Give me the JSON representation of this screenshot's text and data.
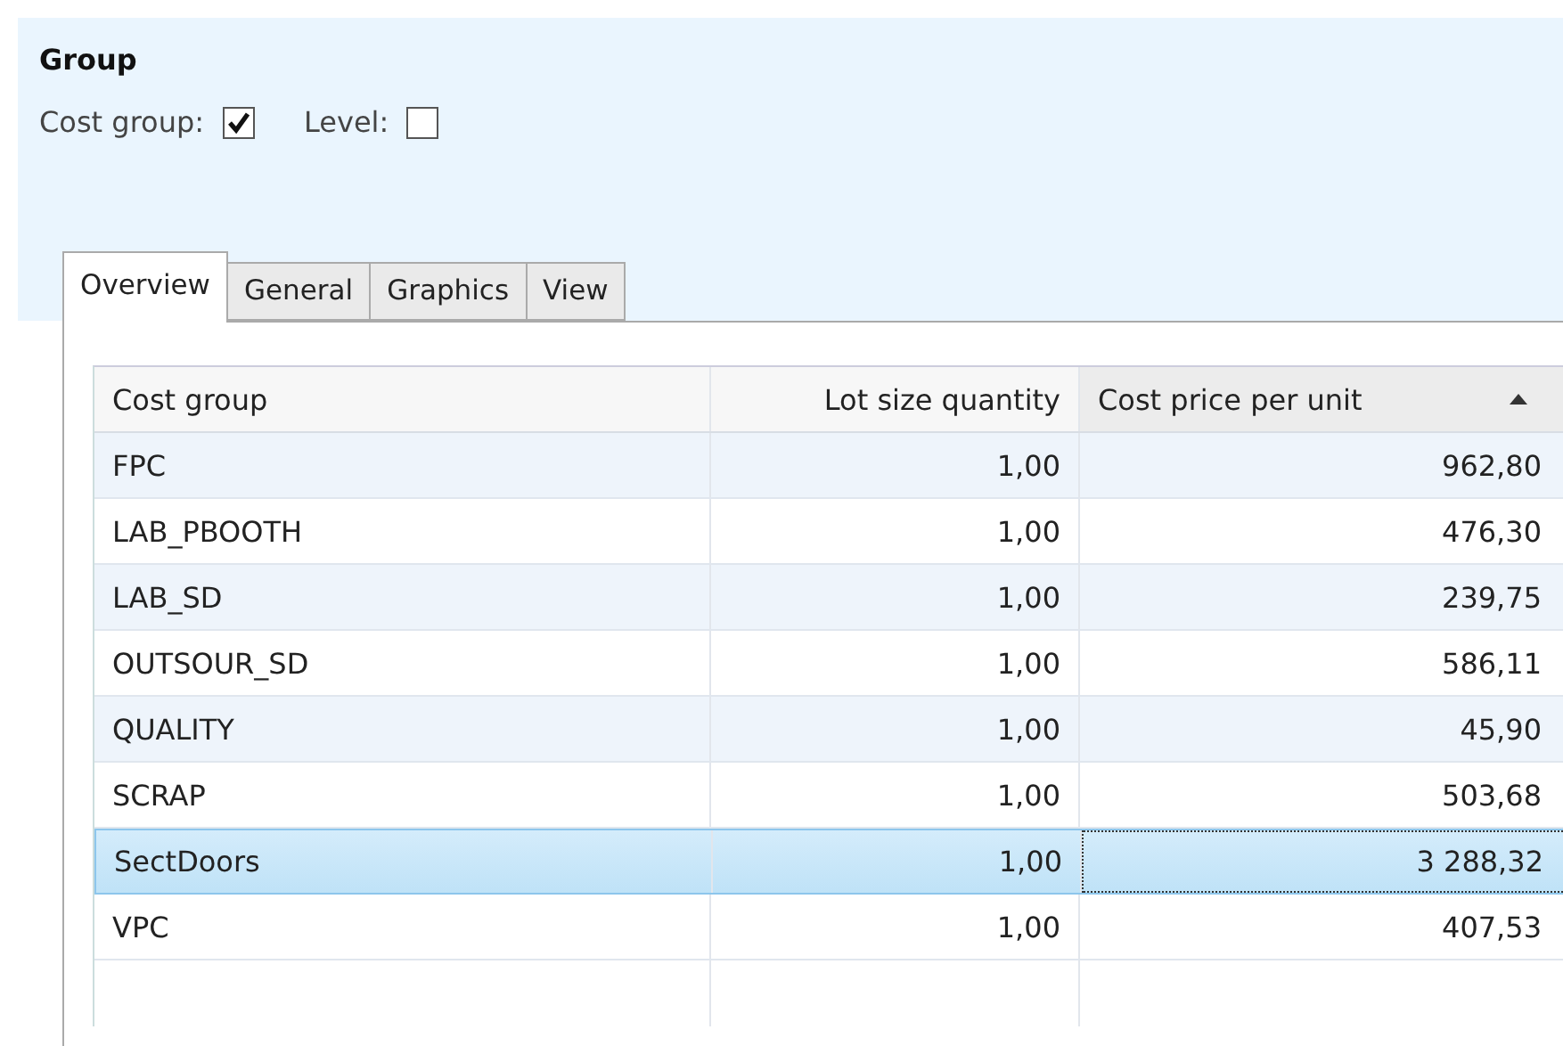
{
  "group": {
    "title": "Group",
    "fields": [
      {
        "label": "Cost group:",
        "checked": true
      },
      {
        "label": "Level:",
        "checked": false
      }
    ]
  },
  "tabs": [
    {
      "label": "Overview",
      "selected": true
    },
    {
      "label": "General",
      "selected": false
    },
    {
      "label": "Graphics",
      "selected": false
    },
    {
      "label": "View",
      "selected": false
    }
  ],
  "table": {
    "columns": [
      {
        "label": "Cost group",
        "sorted": false
      },
      {
        "label": "Lot size quantity",
        "sorted": false
      },
      {
        "label": "Cost price per unit",
        "sorted": true
      }
    ],
    "rows": [
      {
        "cells": [
          "FPC",
          "1,00",
          "962,80"
        ],
        "selected": false
      },
      {
        "cells": [
          "LAB_PBOOTH",
          "1,00",
          "476,30"
        ],
        "selected": false
      },
      {
        "cells": [
          "LAB_SD",
          "1,00",
          "239,75"
        ],
        "selected": false
      },
      {
        "cells": [
          "OUTSOUR_SD",
          "1,00",
          "586,11"
        ],
        "selected": false
      },
      {
        "cells": [
          "QUALITY",
          "1,00",
          "45,90"
        ],
        "selected": false
      },
      {
        "cells": [
          "SCRAP",
          "1,00",
          "503,68"
        ],
        "selected": false
      },
      {
        "cells": [
          "SectDoors",
          "1,00",
          "3 288,32"
        ],
        "selected": true
      },
      {
        "cells": [
          "VPC",
          "1,00",
          "407,53"
        ],
        "selected": false
      }
    ]
  }
}
